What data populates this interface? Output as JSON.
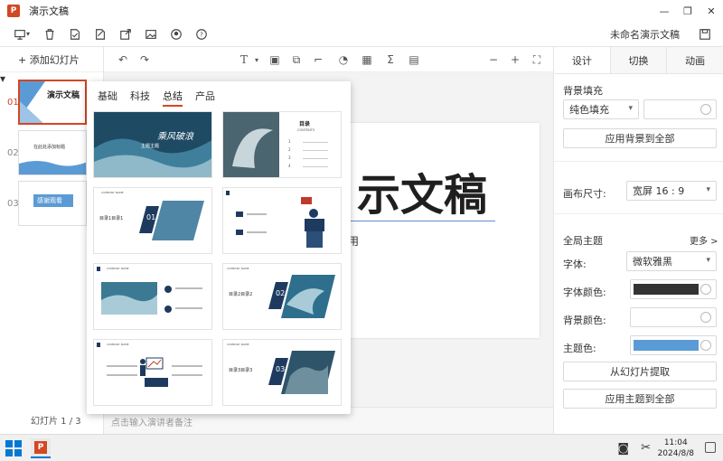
{
  "app": {
    "title": "演示文稿",
    "logo_letter": "P"
  },
  "toolbar": {
    "doc_name": "未命名演示文稿"
  },
  "left_panel": {
    "add_slide": "+ 添加幻灯片",
    "slides": [
      {
        "num": "01",
        "title": "演示文稿"
      },
      {
        "num": "02",
        "title": "在此处添加标题"
      },
      {
        "num": "03",
        "title": "感谢观看"
      }
    ],
    "slide_count": "幻灯片 1 / 3"
  },
  "canvas": {
    "title": "示文稿",
    "subtitle": "用"
  },
  "notes": {
    "placeholder": "点击输入演讲者备注"
  },
  "template_panel": {
    "tabs": [
      "基础",
      "科技",
      "总结",
      "产品"
    ],
    "cards": [
      {
        "title": "乘风破浪",
        "subtitle": "主题主题"
      },
      {
        "title": "目录",
        "subtitle": "CONTENTS",
        "items": [
          "1",
          "2",
          "3",
          "4"
        ]
      },
      {
        "title": "目录1目录1",
        "num": "01",
        "header": "COMPANY NAME"
      },
      {
        "header": ""
      },
      {
        "header": "COMPANY NAME"
      },
      {
        "title": "目录2目录2",
        "num": "02",
        "header": "COMPANY NAME"
      },
      {
        "header": "COMPANY NAME"
      },
      {
        "title": "目录3目录3",
        "num": "03",
        "header": "COMPANY NAME"
      }
    ]
  },
  "right_panel": {
    "tabs": [
      "设计",
      "切换",
      "动画"
    ],
    "bg_fill_label": "背景填充",
    "bg_fill_value": "纯色填充",
    "apply_bg_all": "应用背景到全部",
    "canvas_size_label": "画布尺寸:",
    "canvas_size_value": "宽屏 16 : 9",
    "global_theme_label": "全局主题",
    "more_label": "更多 >",
    "font_label": "字体:",
    "font_value": "微软雅黑",
    "font_color_label": "字体颜色:",
    "bg_color_label": "背景颜色:",
    "theme_color_label": "主题色:",
    "extract_btn": "从幻灯片提取",
    "apply_theme_all": "应用主题到全部",
    "font_color": "#333333",
    "theme_color": "#5b9bd5"
  },
  "taskbar": {
    "time": "11:04",
    "date": "2024/8/8"
  }
}
